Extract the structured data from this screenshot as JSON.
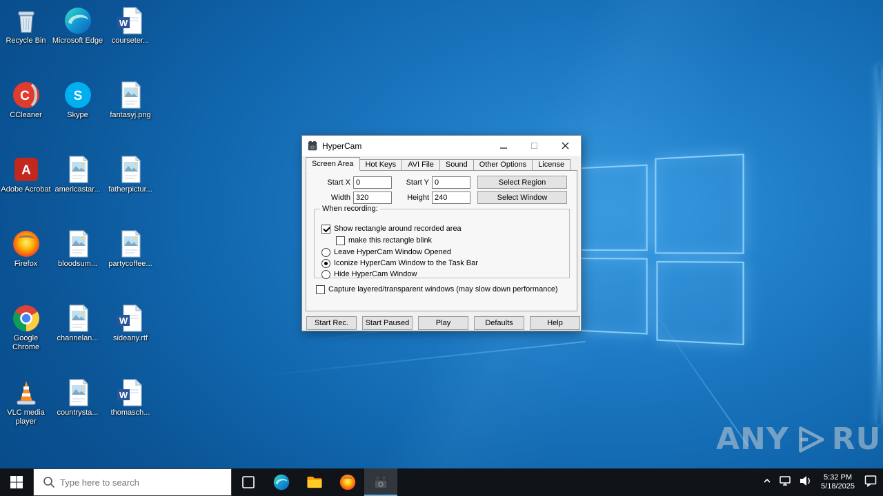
{
  "desktop": {
    "icons": [
      {
        "label": "Recycle Bin"
      },
      {
        "label": "Microsoft Edge"
      },
      {
        "label": "courseter..."
      },
      {
        "label": "CCleaner"
      },
      {
        "label": "Skype"
      },
      {
        "label": "fantasyj.png"
      },
      {
        "label": "Adobe Acrobat"
      },
      {
        "label": "americastar..."
      },
      {
        "label": "fatherpictur..."
      },
      {
        "label": "Firefox"
      },
      {
        "label": "bloodsum..."
      },
      {
        "label": "partycoffee..."
      },
      {
        "label": "Google Chrome"
      },
      {
        "label": "channelan..."
      },
      {
        "label": "sideany.rtf"
      },
      {
        "label": "VLC media player"
      },
      {
        "label": "countrysta..."
      },
      {
        "label": "thomasch..."
      }
    ]
  },
  "watermark": {
    "any": "ANY",
    "run": "RUN"
  },
  "hypercam": {
    "title": "HyperCam",
    "tabs": [
      "Screen Area",
      "Hot Keys",
      "AVI File",
      "Sound",
      "Other Options",
      "License"
    ],
    "fields": {
      "start_x": {
        "label": "Start X",
        "value": "0"
      },
      "start_y": {
        "label": "Start Y",
        "value": "0"
      },
      "width": {
        "label": "Width",
        "value": "320"
      },
      "height": {
        "label": "Height",
        "value": "240"
      }
    },
    "buttons": {
      "select_region": "Select Region",
      "select_window": "Select Window"
    },
    "group": {
      "label": "When recording:",
      "options": [
        {
          "label": "Show rectangle around recorded area",
          "type": "checkbox",
          "checked": true
        },
        {
          "label": "make this rectangle blink",
          "type": "checkbox",
          "checked": false
        },
        {
          "label": "Leave HyperCam Window Opened",
          "type": "radio",
          "checked": false
        },
        {
          "label": "Iconize HyperCam Window to the Task Bar",
          "type": "radio",
          "checked": true
        },
        {
          "label": "Hide HyperCam Window",
          "type": "radio",
          "checked": false
        }
      ]
    },
    "capture_label": "Capture layered/transparent windows (may slow down performance)",
    "actions": [
      "Start Rec.",
      "Start Paused",
      "Play",
      "Defaults",
      "Help"
    ]
  },
  "taskbar": {
    "search_placeholder": "Type here to search",
    "clock": {
      "time": "5:32 PM",
      "date": "5/18/2025"
    }
  },
  "colors": {
    "wallpaper_blue": "#1873bd",
    "taskbar_black": "#101418",
    "active_underline": "#6cb2e2"
  }
}
